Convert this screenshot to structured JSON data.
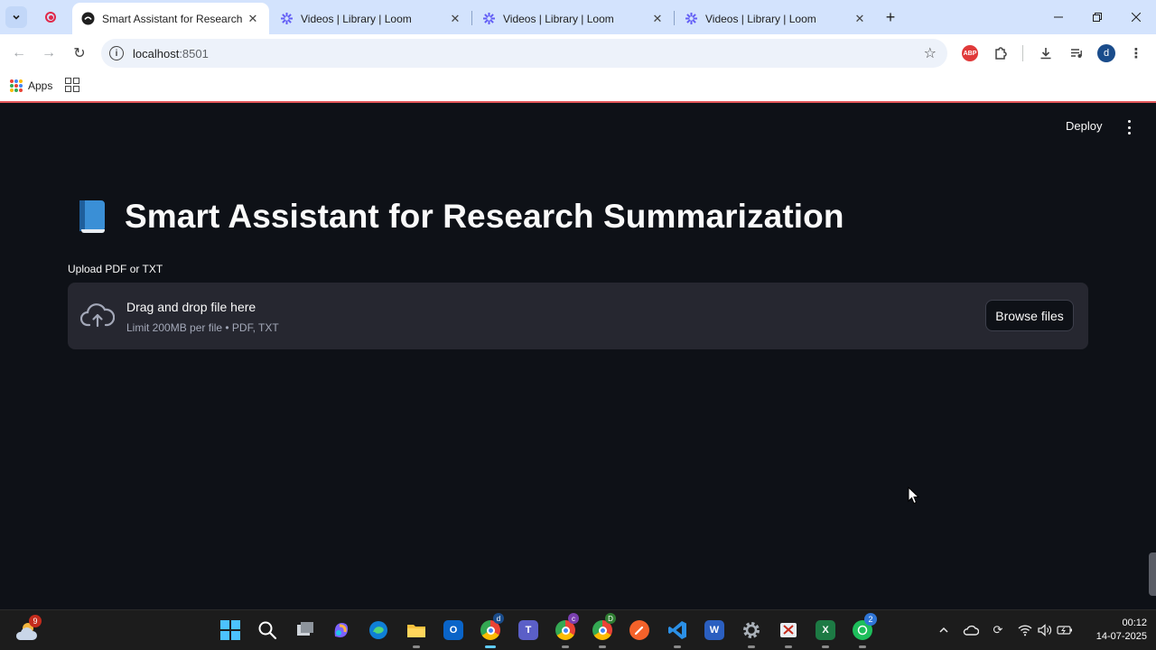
{
  "browser": {
    "tabs": [
      {
        "title": "Smart Assistant for Research",
        "active": true
      },
      {
        "title": "Videos | Library | Loom",
        "active": false
      },
      {
        "title": "Videos | Library | Loom",
        "active": false
      },
      {
        "title": "Videos | Library | Loom",
        "active": false
      }
    ],
    "url_host": "localhost",
    "url_port": ":8501",
    "bookmarks": {
      "apps_label": "Apps"
    },
    "profile_initial": "d",
    "extension_label": "ABP"
  },
  "app": {
    "deploy_label": "Deploy",
    "title": "Smart Assistant for Research Summarization",
    "uploader": {
      "label": "Upload PDF or TXT",
      "drop_text": "Drag and drop file here",
      "limit_text": "Limit 200MB per file • PDF, TXT",
      "browse_label": "Browse files"
    }
  },
  "taskbar": {
    "weather_badge": "9",
    "chrome_badge": "d",
    "chrome2_badge": "c",
    "chrome3_badge": "D",
    "whatsapp_badge": "2",
    "time": "00:12",
    "date": "14-07-2025"
  },
  "colors": {
    "app_bg": "#0e1117",
    "dropzone_bg": "#262730",
    "tab_strip": "#d3e3fd",
    "accent_red": "#e3575a"
  }
}
